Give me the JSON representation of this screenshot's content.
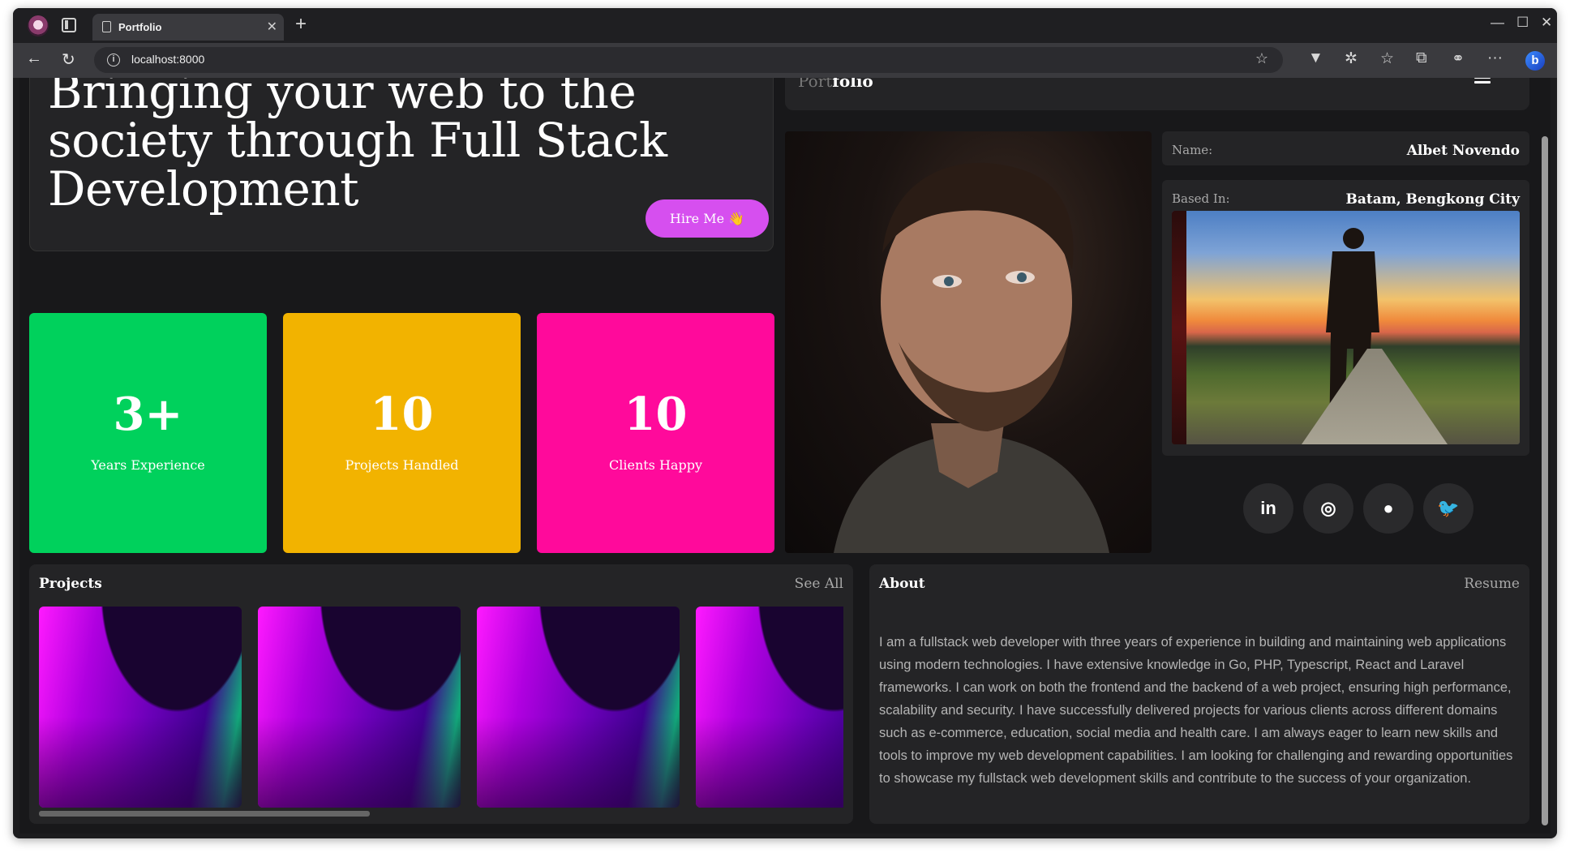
{
  "browser": {
    "tab_title": "Portfolio",
    "url": "localhost:8000"
  },
  "hero": {
    "headline": "Bringing your web to the society through Full Stack Development",
    "hire_label": "Hire Me 👋"
  },
  "stats": [
    {
      "value": "3+",
      "label": "Years Experience",
      "color": "#00d15c"
    },
    {
      "value": "10",
      "label": "Projects Handled",
      "color": "#f2b300"
    },
    {
      "value": "10",
      "label": "Clients Happy",
      "color": "#ff0a9b"
    }
  ],
  "nav": {
    "logo_dim": "Port",
    "logo_bold": "folio"
  },
  "profile": {
    "name_key": "Name:",
    "name_value": "Albet Novendo",
    "based_key": "Based In:",
    "based_value": "Batam, Bengkong City"
  },
  "social": [
    {
      "label": "in",
      "icon": "linkedin-icon"
    },
    {
      "label": "◎",
      "icon": "instagram-icon"
    },
    {
      "label": "●",
      "icon": "github-icon"
    },
    {
      "label": "🐦",
      "icon": "twitter-icon"
    }
  ],
  "projects": {
    "title": "Projects",
    "link": "See All"
  },
  "about": {
    "title": "About",
    "link": "Resume",
    "text": "I am a fullstack web developer with three years of experience in building and maintaining web applications using modern technologies. I have extensive knowledge in Go, PHP, Typescript, React and Laravel frameworks. I can work on both the frontend and the backend of a web project, ensuring high performance, scalability and security. I have successfully delivered projects for various clients across different domains such as e-commerce, education, social media and health care. I am always eager to learn new skills and tools to improve my web development capabilities. I am looking for challenging and rewarding opportunities to showcase my fullstack web development skills and contribute to the success of your organization."
  }
}
